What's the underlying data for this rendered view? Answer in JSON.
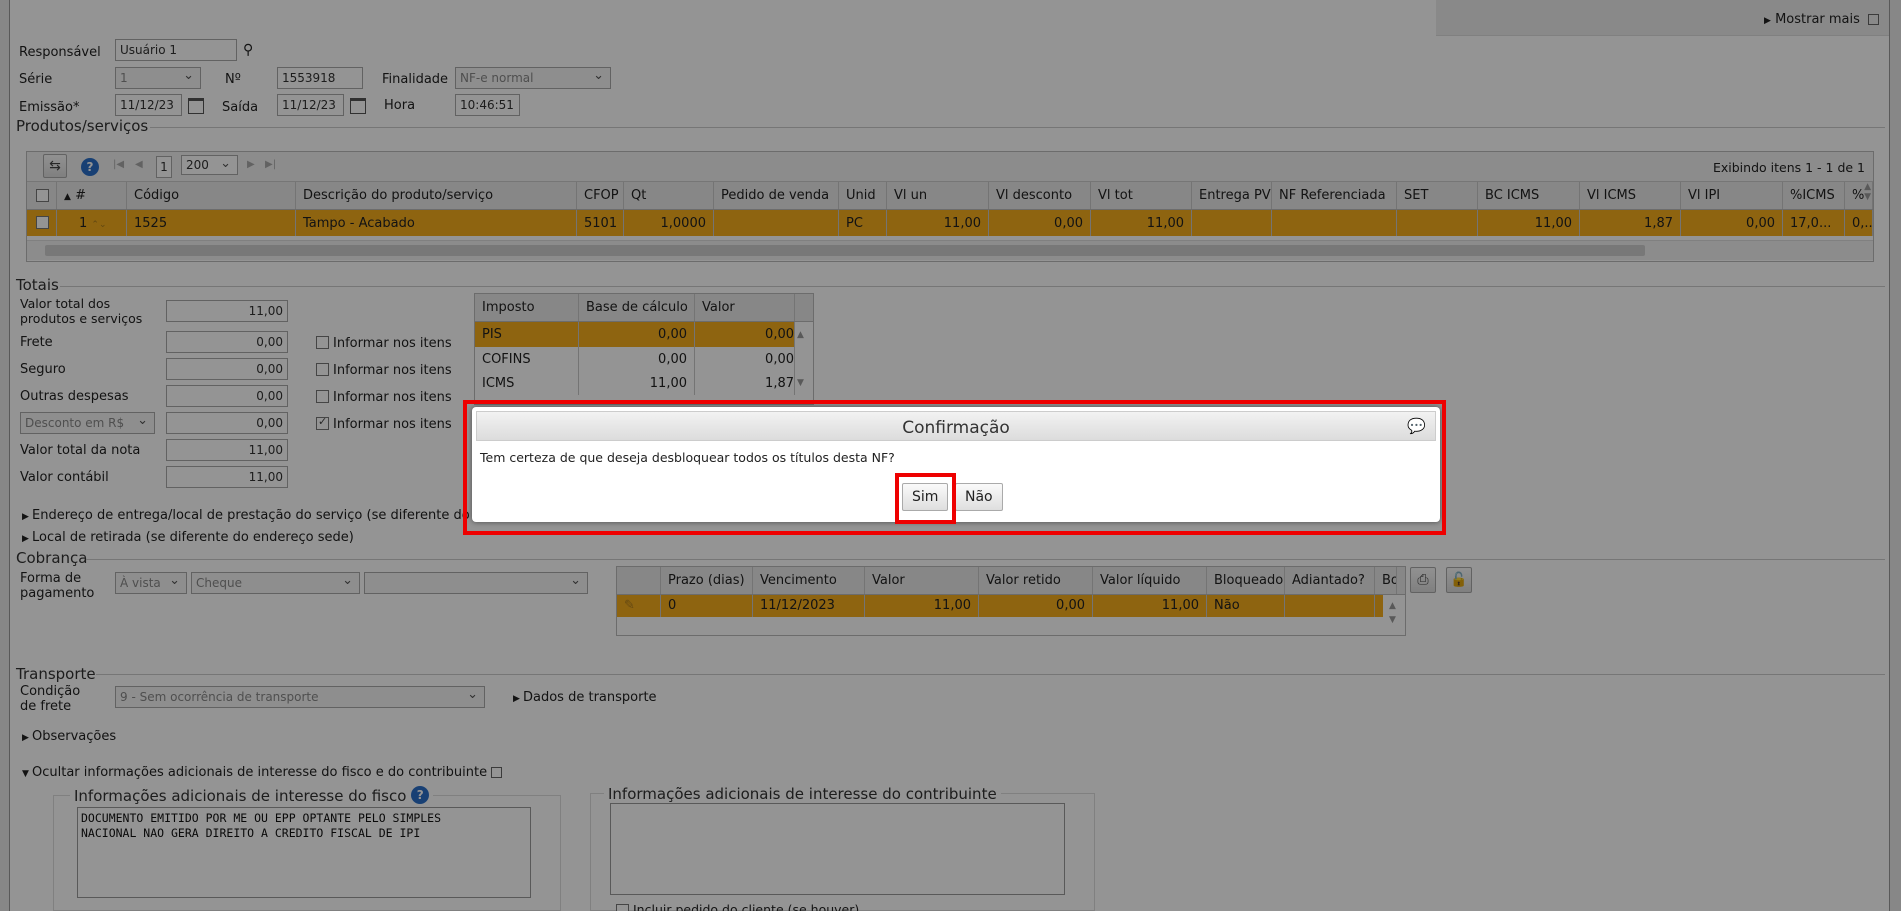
{
  "header": {
    "show_more": "Mostrar mais"
  },
  "form": {
    "responsavel_label": "Responsável",
    "responsavel_value": "Usuário 1",
    "serie_label": "Série",
    "serie_value": "1",
    "numero_label": "Nº",
    "numero_value": "1553918",
    "finalidade_label": "Finalidade",
    "finalidade_value": "NF-e normal",
    "emissao_label": "Emissão*",
    "emissao_value": "11/12/23",
    "saida_label": "Saída",
    "saida_value": "11/12/23",
    "hora_label": "Hora",
    "hora_value": "10:46:51"
  },
  "products": {
    "title": "Produtos/serviços",
    "page": "1",
    "page_size": "200",
    "status": "Exibindo itens 1 - 1 de 1",
    "columns": [
      "#",
      "Código",
      "Descrição do produto/serviço",
      "CFOP",
      "Qt",
      "Pedido de venda",
      "Unid",
      "Vl un",
      "Vl desconto",
      "Vl tot",
      "Entrega PV",
      "NF Referenciada",
      "SET",
      "BC ICMS",
      "Vl ICMS",
      "Vl IPI",
      "%ICMS",
      "%"
    ],
    "rows": [
      {
        "num": "1",
        "codigo": "1525",
        "descricao": "Tampo - Acabado",
        "cfop": "5101",
        "qt": "1,0000",
        "pedido": "",
        "unid": "PC",
        "vl_un": "11,00",
        "vl_desconto": "0,00",
        "vl_tot": "11,00",
        "entrega": "",
        "nf_ref": "",
        "set": "",
        "bc_icms": "11,00",
        "vl_icms": "1,87",
        "vl_ipi": "0,00",
        "pct_icms": "17,0...",
        "pct": "0,..."
      }
    ]
  },
  "totais": {
    "title": "Totais",
    "valor_total_label": "Valor total dos produtos e serviços",
    "valor_total": "11,00",
    "frete_label": "Frete",
    "frete": "0,00",
    "seguro_label": "Seguro",
    "seguro": "0,00",
    "outras_label": "Outras despesas",
    "outras": "0,00",
    "desconto_select": "Desconto em R$",
    "desconto": "0,00",
    "valor_nota_label": "Valor total da nota",
    "valor_nota": "11,00",
    "valor_contabil_label": "Valor contábil",
    "valor_contabil": "11,00",
    "informar_label": "Informar nos itens"
  },
  "impostos": {
    "columns": [
      "Imposto",
      "Base de cálculo",
      "Valor"
    ],
    "rows": [
      {
        "imposto": "PIS",
        "base": "0,00",
        "valor": "0,00"
      },
      {
        "imposto": "COFINS",
        "base": "0,00",
        "valor": "0,00"
      },
      {
        "imposto": "ICMS",
        "base": "11,00",
        "valor": "1,87"
      }
    ]
  },
  "sections": {
    "endereco_entrega": "Endereço de entrega/local de prestação do serviço (se diferente do end",
    "local_retirada": "Local de retirada (se diferente do endereço sede)"
  },
  "cobranca": {
    "title": "Cobrança",
    "forma_label": "Forma de pagamento",
    "forma_value": "À vista",
    "tipo_value": "Cheque",
    "extra_value": "",
    "columns": [
      "Prazo (dias)",
      "Vencimento",
      "Valor",
      "Valor retido",
      "Valor líquido",
      "Bloqueado",
      "Adiantado?",
      "Bo"
    ],
    "rows": [
      {
        "prazo": "0",
        "vencimento": "11/12/2023",
        "valor": "11,00",
        "retido": "0,00",
        "liquido": "11,00",
        "bloqueado": "Não",
        "adiantado": ""
      }
    ]
  },
  "transporte": {
    "title": "Transporte",
    "condicao_label": "Condição de frete",
    "condicao_value": "9 - Sem ocorrência de transporte",
    "dados_label": "Dados de transporte",
    "observacoes": "Observações",
    "ocultar_info": "Ocultar informações adicionais de interesse do fisco e do contribuinte"
  },
  "info": {
    "fisco_title": "Informações adicionais de interesse do fisco",
    "fisco_text": "DOCUMENTO EMITIDO POR ME OU EPP OPTANTE PELO SIMPLES\nNACIONAL NAO GERA DIREITO A CREDITO FISCAL DE IPI",
    "contribuinte_title": "Informações adicionais de interesse do contribuinte",
    "contribuinte_text": "",
    "incluir_pedido": "Incluir pedido do cliente (se houver)"
  },
  "dialog": {
    "title": "Confirmação",
    "message": "Tem certeza de que deseja desbloquear todos os títulos desta NF?",
    "yes": "Sim",
    "no": "Não"
  },
  "colors": {
    "row_highlight": "#f5ad1d",
    "annotation_red": "#e00000"
  }
}
